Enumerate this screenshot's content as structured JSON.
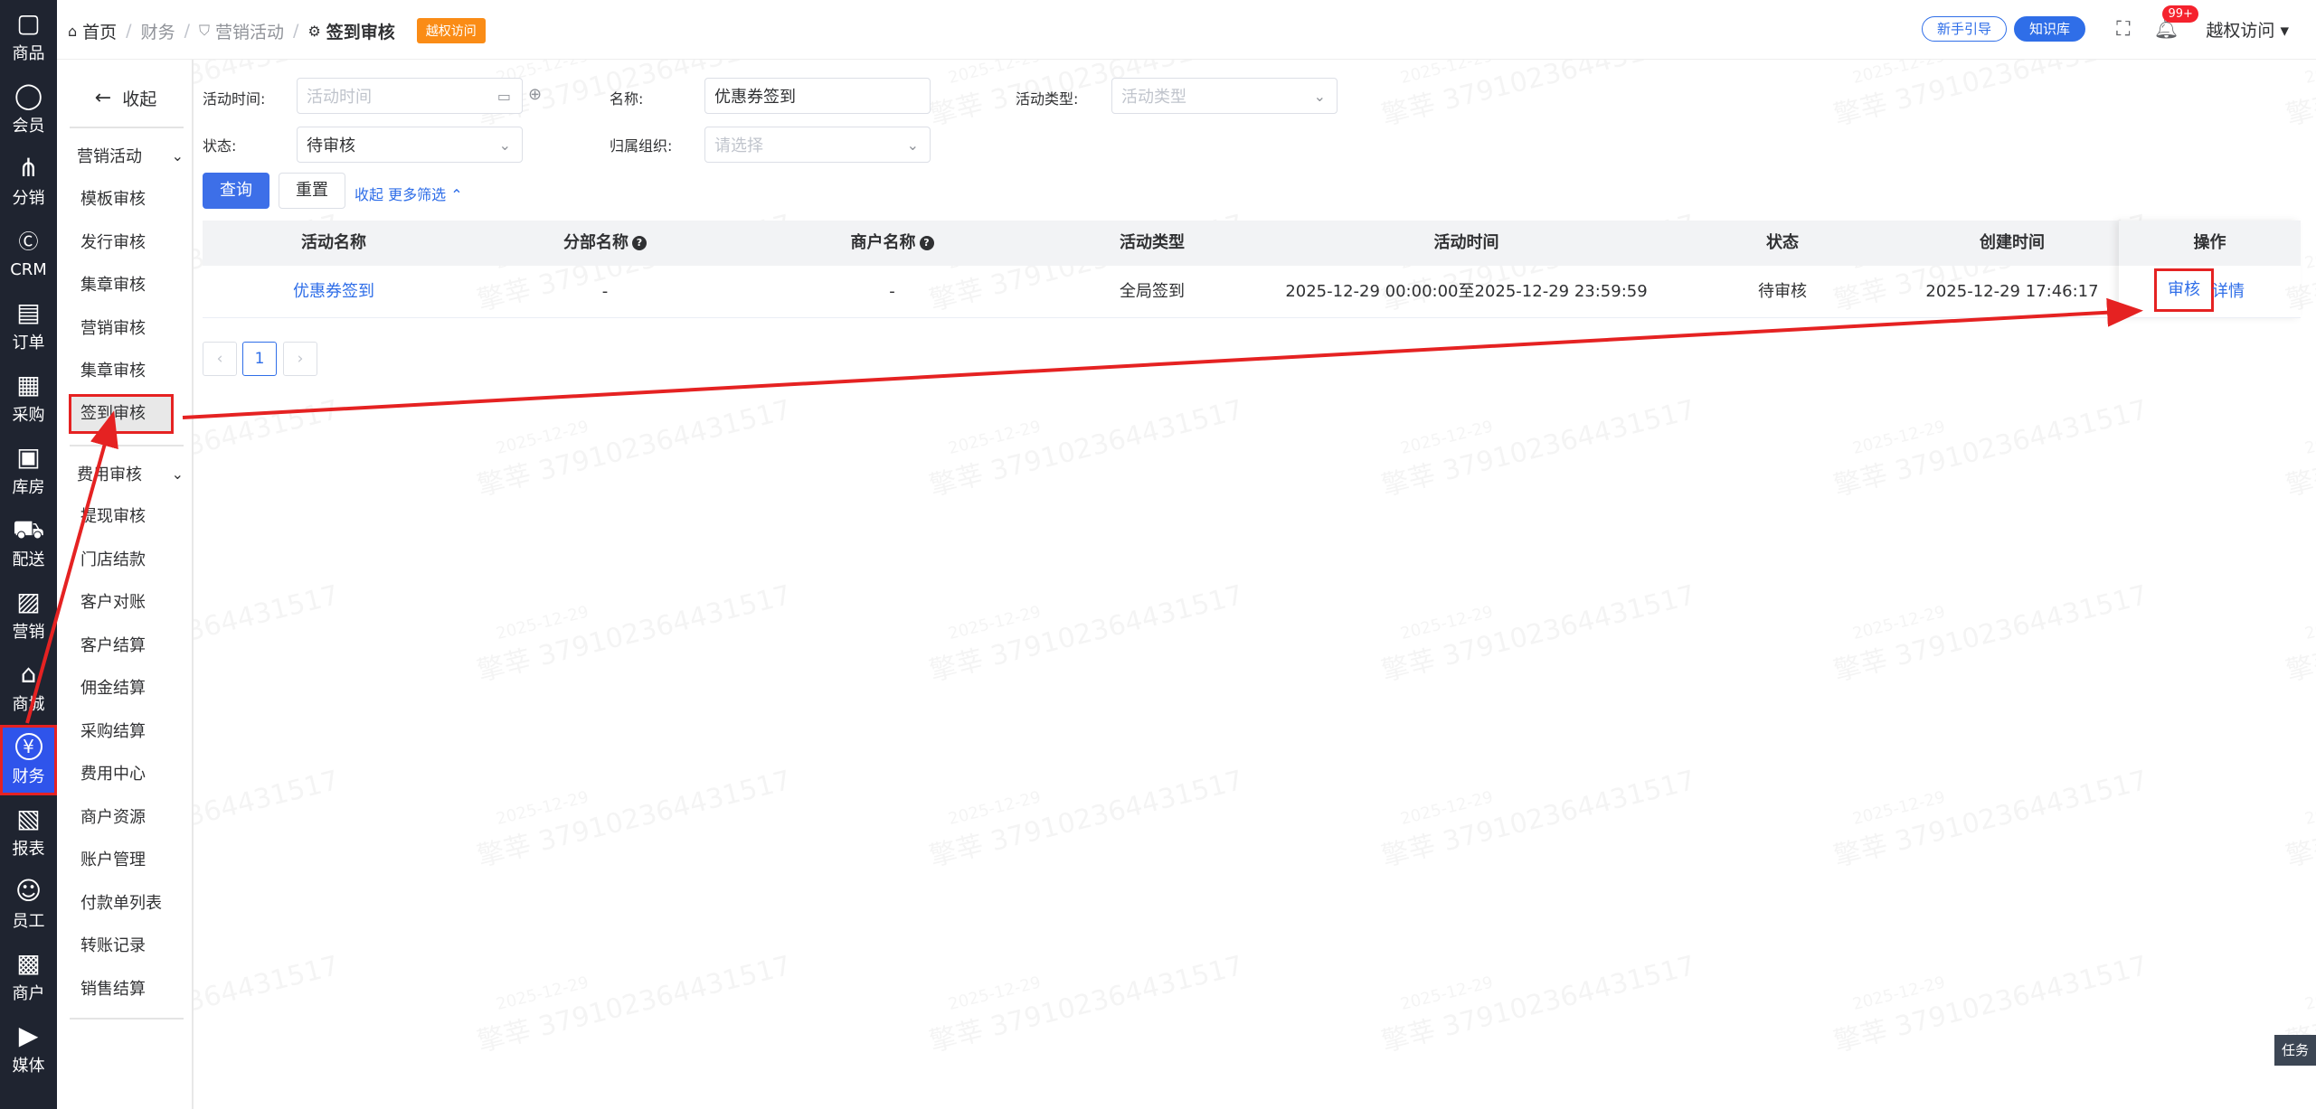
{
  "rail": [
    {
      "label": "商品",
      "icon": "goods-icon"
    },
    {
      "label": "会员",
      "icon": "member-icon"
    },
    {
      "label": "分销",
      "icon": "distribution-icon"
    },
    {
      "label": "CRM",
      "icon": "crm-icon"
    },
    {
      "label": "订单",
      "icon": "order-icon"
    },
    {
      "label": "采购",
      "icon": "purchase-icon"
    },
    {
      "label": "库房",
      "icon": "warehouse-icon"
    },
    {
      "label": "配送",
      "icon": "delivery-icon"
    },
    {
      "label": "营销",
      "icon": "gift-icon"
    },
    {
      "label": "商城",
      "icon": "mall-icon"
    },
    {
      "label": "财务",
      "icon": "yen-icon",
      "active": true
    },
    {
      "label": "报表",
      "icon": "report-icon"
    },
    {
      "label": "员工",
      "icon": "staff-icon"
    },
    {
      "label": "商户",
      "icon": "merchant-icon"
    },
    {
      "label": "媒体",
      "icon": "media-icon"
    }
  ],
  "submenu": {
    "collapse_label": "收起",
    "group1": "营销活动",
    "group1_items": [
      "模板审核",
      "发行审核",
      "集章审核",
      "营销审核",
      "集章审核",
      "签到审核"
    ],
    "group2": "费用审核",
    "group2_items": [
      "提现审核",
      "门店结款",
      "客户对账",
      "客户结算",
      "佣金结算",
      "采购结算",
      "费用中心",
      "商户资源",
      "账户管理",
      "付款单列表",
      "转账记录",
      "销售结算"
    ]
  },
  "breadcrumb": {
    "home": "首页",
    "finance": "财务",
    "marketing": "营销活动",
    "current": "签到审核",
    "tag": "越权访问"
  },
  "header": {
    "guide_label": "新手引导",
    "kb_label": "知识库",
    "badge": "99+",
    "user": "越权访问"
  },
  "filters": {
    "time_label": "活动时间:",
    "time_placeholder": "活动时间",
    "name_label": "名称:",
    "name_value": "优惠券签到",
    "type_label": "活动类型:",
    "type_placeholder": "活动类型",
    "status_label": "状态:",
    "status_value": "待审核",
    "org_label": "归属组织:",
    "org_placeholder": "请选择",
    "query_label": "查询",
    "reset_label": "重置",
    "collapse_label": "收起",
    "more_label": "更多筛选"
  },
  "table": {
    "headers": [
      "活动名称",
      "分部名称",
      "商户名称",
      "活动类型",
      "活动时间",
      "状态",
      "创建时间",
      "操作"
    ],
    "row": {
      "name": "优惠券签到",
      "branch": "-",
      "merchant": "-",
      "type": "全局签到",
      "time": "2025-12-29 00:00:00至2025-12-29 23:59:59",
      "status": "待审核",
      "created": "2025-12-29 17:46:17",
      "op_audit": "审核",
      "op_detail": "详情"
    }
  },
  "pagination": {
    "current": "1",
    "prev": "‹",
    "next": "›"
  },
  "watermark": {
    "text": "擎莘 379102364431517",
    "date": "2025-12-29"
  },
  "task_label": "任务",
  "colors": {
    "primary": "#3d6fe8",
    "rail": "#1f2430",
    "highlight": "#e52222",
    "tag": "#fa8c16"
  }
}
